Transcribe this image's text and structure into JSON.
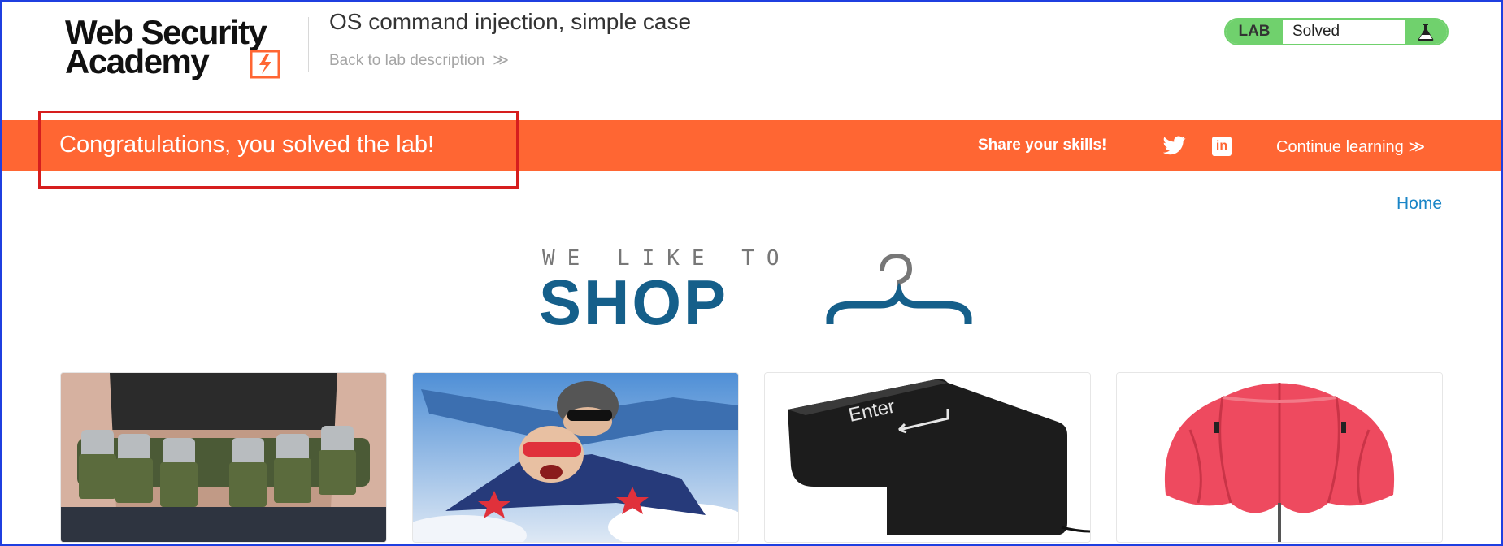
{
  "header": {
    "logo_line1": "Web Security",
    "logo_line2": "Academy",
    "lab_title": "OS command injection, simple case",
    "back_link": "Back to lab description",
    "lab_badge": "LAB",
    "lab_status": "Solved"
  },
  "banner": {
    "message": "Congratulations, you solved the lab!",
    "share_label": "Share your skills!",
    "continue_label": "Continue learning"
  },
  "nav": {
    "home": "Home"
  },
  "shop_logo": {
    "tagline": "WE LIKE TO",
    "word": "SHOP"
  },
  "products": [
    {
      "image": "beer-belt-photo"
    },
    {
      "image": "tandem-skydive-photo"
    },
    {
      "image": "giant-enter-key-photo"
    },
    {
      "image": "double-umbrella-photo"
    }
  ],
  "colors": {
    "banner": "#ff6633",
    "lab_solved": "#70d16d",
    "link": "#1a85c7",
    "shop_logo": "#155f8a",
    "highlight": "#d61e1e"
  }
}
